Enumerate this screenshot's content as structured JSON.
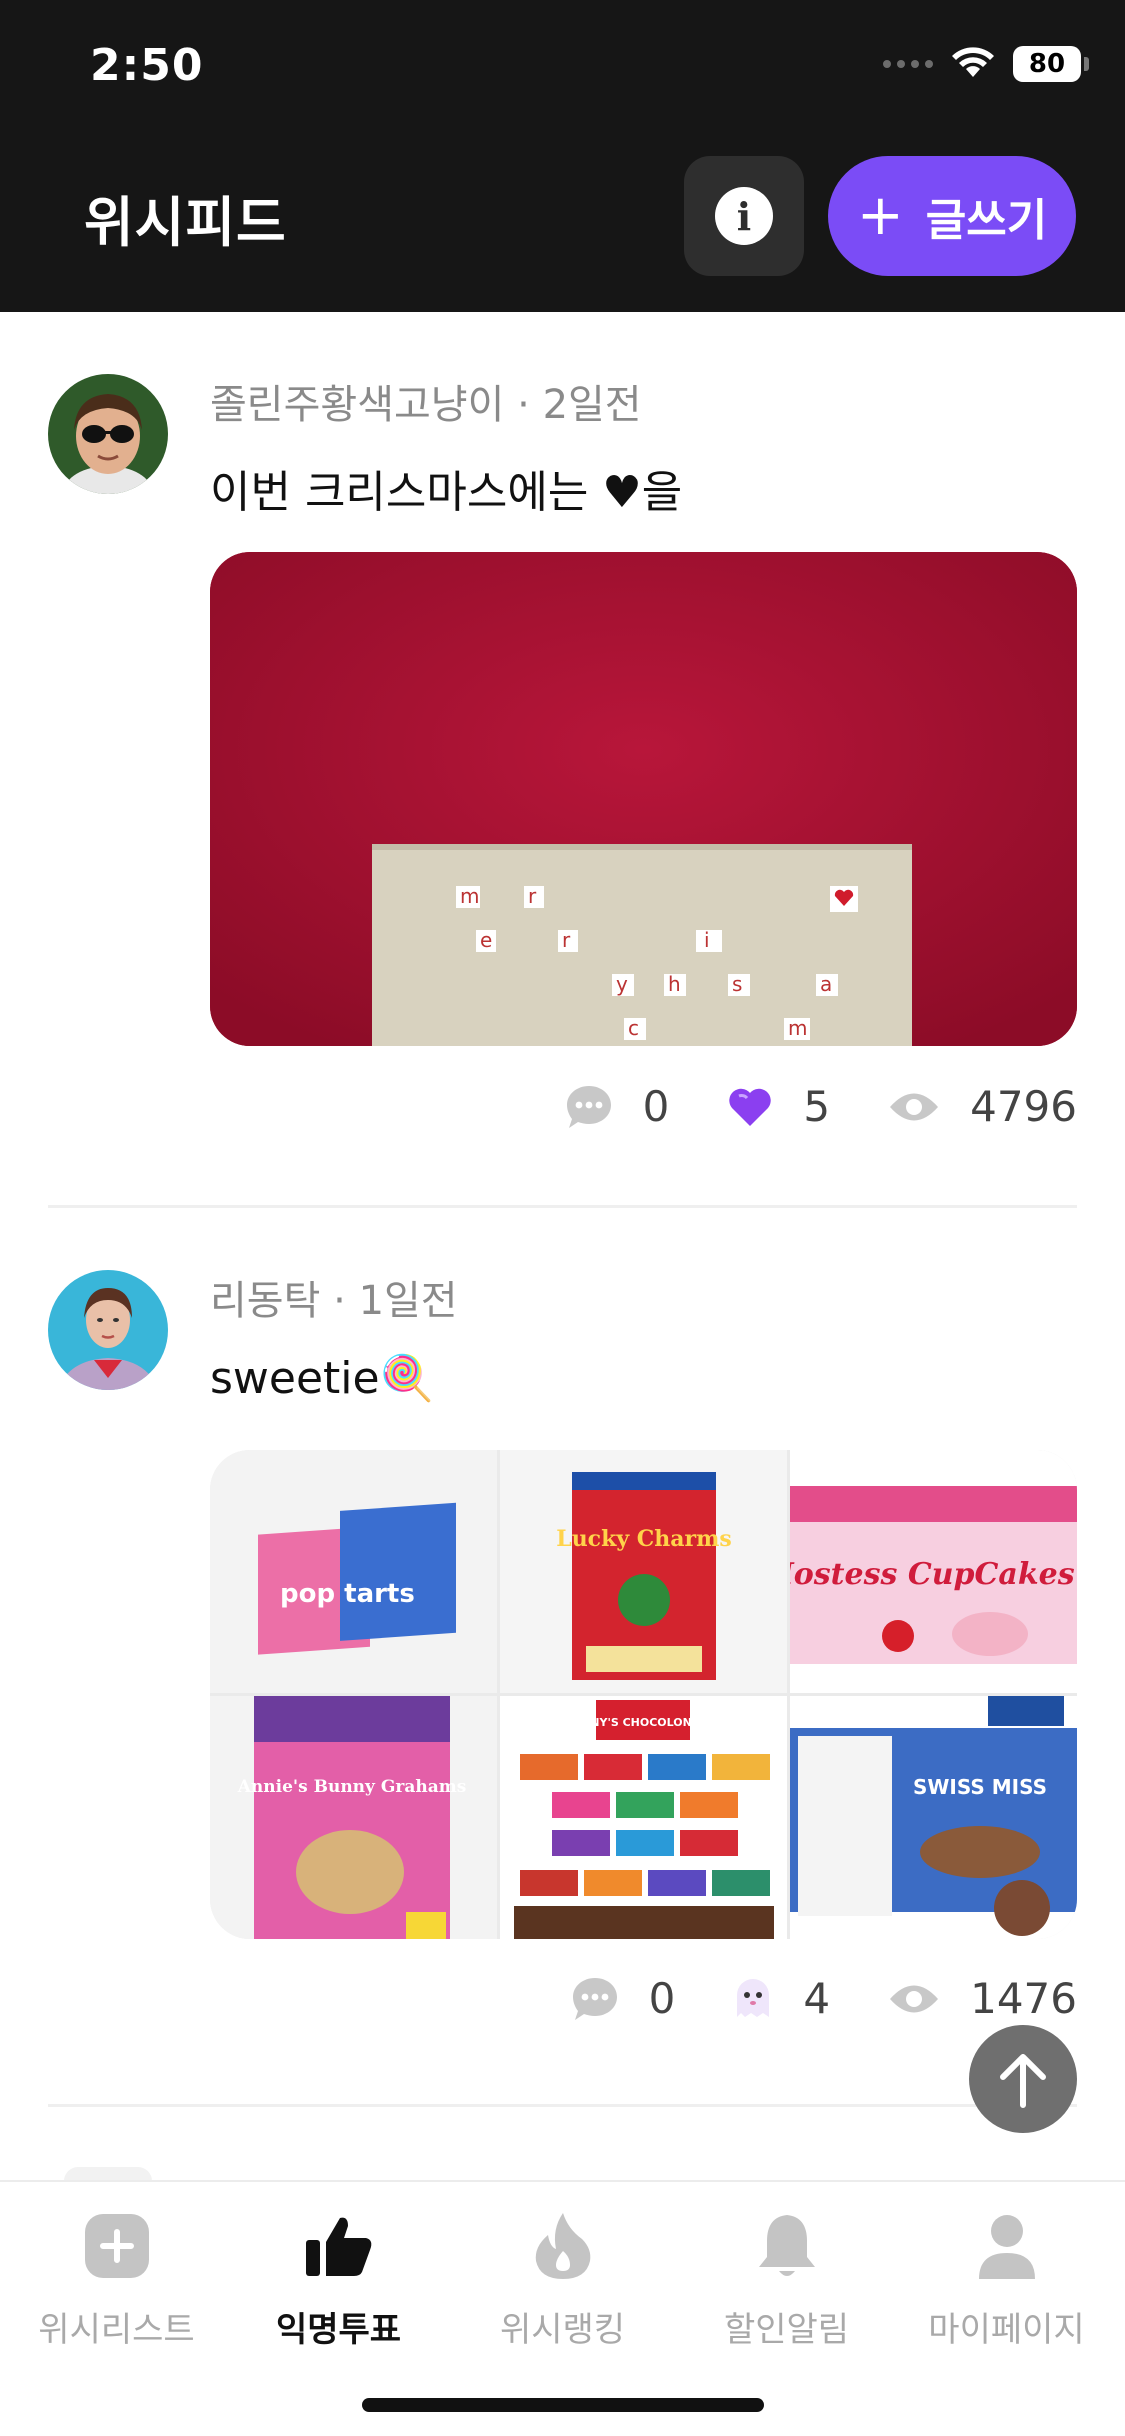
{
  "status_bar": {
    "time": "2:50",
    "battery": "80"
  },
  "header": {
    "title": "위시피드",
    "info_icon": "i",
    "write_label": "글쓰기",
    "write_plus": "+"
  },
  "posts": [
    {
      "author": "졸린주황색고냥이",
      "time_ago": "2일전",
      "text": "이번 크리스마스에는 ♥을",
      "image_letters": [
        "m",
        "r",
        "e",
        "r",
        "i",
        "y",
        "h",
        "s",
        "a",
        "c",
        "m"
      ],
      "comments": "0",
      "likes": "5",
      "like_icon": "purple-heart-icon",
      "views": "4796"
    },
    {
      "author": "리동탁",
      "time_ago": "1일전",
      "text": "sweetie🍭",
      "products": [
        {
          "name": "pop tarts"
        },
        {
          "name": "Lucky Charms"
        },
        {
          "name": "Hostess CupCakes"
        },
        {
          "name": "Annie's Bunny Grahams"
        },
        {
          "name": "TONY'S CHOCOLONELY"
        },
        {
          "name": "SWISS MISS"
        }
      ],
      "comments": "0",
      "likes": "4",
      "like_icon": "ghost-icon",
      "views": "1476"
    }
  ],
  "bottom_nav": [
    {
      "label": "위시리스트",
      "icon": "plus-square-icon",
      "active": false
    },
    {
      "label": "익명투표",
      "icon": "thumbs-up-icon",
      "active": true
    },
    {
      "label": "위시랭킹",
      "icon": "flame-icon",
      "active": false
    },
    {
      "label": "할인알림",
      "icon": "bell-icon",
      "active": false
    },
    {
      "label": "마이페이지",
      "icon": "user-icon",
      "active": false
    }
  ],
  "colors": {
    "accent": "#7b4cf6",
    "header_bg": "#161616",
    "like_purple": "#8b3ff0"
  }
}
